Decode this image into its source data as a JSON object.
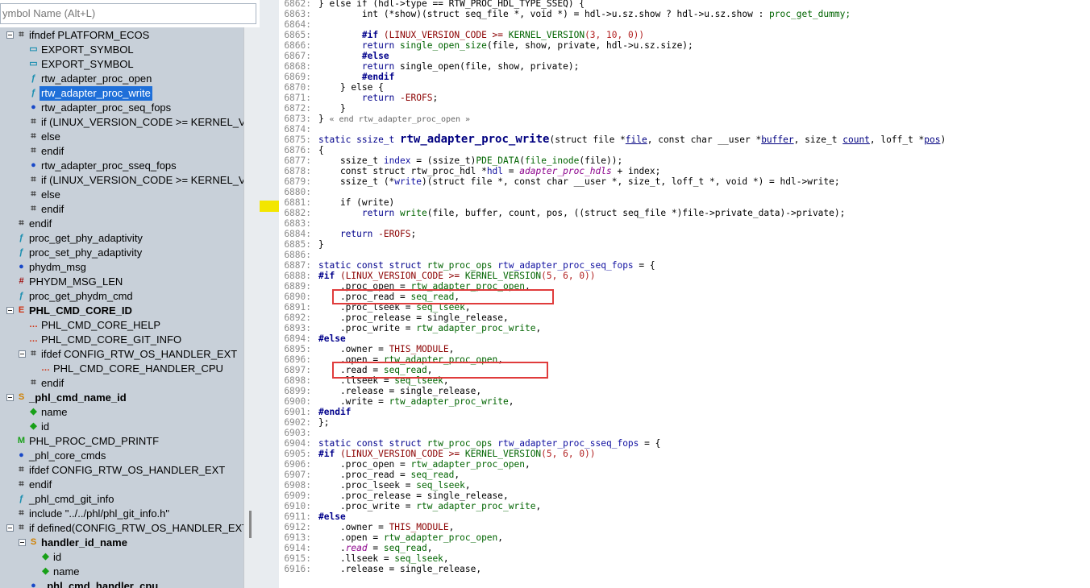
{
  "search": {
    "placeholder": "ymbol Name (Alt+L)"
  },
  "tree": [
    {
      "label": "ifndef PLATFORM_ECOS",
      "indent": 0,
      "box": true,
      "icon": "preproc-icon",
      "bold": false,
      "sel": false
    },
    {
      "label": "EXPORT_SYMBOL",
      "indent": 1,
      "box": false,
      "icon": "macro-call-icon",
      "bold": false,
      "sel": false
    },
    {
      "label": "EXPORT_SYMBOL",
      "indent": 1,
      "box": false,
      "icon": "macro-call-icon",
      "bold": false,
      "sel": false
    },
    {
      "label": "rtw_adapter_proc_open",
      "indent": 1,
      "box": false,
      "icon": "function-icon",
      "bold": false,
      "sel": false
    },
    {
      "label": "rtw_adapter_proc_write",
      "indent": 1,
      "box": false,
      "icon": "function-icon",
      "bold": false,
      "sel": true
    },
    {
      "label": "rtw_adapter_proc_seq_fops",
      "indent": 1,
      "box": false,
      "icon": "variable-icon",
      "bold": false,
      "sel": false
    },
    {
      "label": "if (LINUX_VERSION_CODE >= KERNEL_VER",
      "indent": 1,
      "box": false,
      "icon": "preproc-icon",
      "bold": false,
      "sel": false
    },
    {
      "label": "else",
      "indent": 1,
      "box": false,
      "icon": "preproc-icon",
      "bold": false,
      "sel": false
    },
    {
      "label": "endif",
      "indent": 1,
      "box": false,
      "icon": "preproc-icon",
      "bold": false,
      "sel": false
    },
    {
      "label": "rtw_adapter_proc_sseq_fops",
      "indent": 1,
      "box": false,
      "icon": "variable-icon",
      "bold": false,
      "sel": false
    },
    {
      "label": "if (LINUX_VERSION_CODE >= KERNEL_VER",
      "indent": 1,
      "box": false,
      "icon": "preproc-icon",
      "bold": false,
      "sel": false
    },
    {
      "label": "else",
      "indent": 1,
      "box": false,
      "icon": "preproc-icon",
      "bold": false,
      "sel": false
    },
    {
      "label": "endif",
      "indent": 1,
      "box": false,
      "icon": "preproc-icon",
      "bold": false,
      "sel": false
    },
    {
      "label": "endif",
      "indent": 0,
      "box": false,
      "icon": "preproc-icon",
      "bold": false,
      "sel": false
    },
    {
      "label": "proc_get_phy_adaptivity",
      "indent": 0,
      "box": false,
      "icon": "function-icon",
      "bold": false,
      "sel": false
    },
    {
      "label": "proc_set_phy_adaptivity",
      "indent": 0,
      "box": false,
      "icon": "function-icon",
      "bold": false,
      "sel": false
    },
    {
      "label": "phydm_msg",
      "indent": 0,
      "box": false,
      "icon": "variable-icon",
      "bold": false,
      "sel": false
    },
    {
      "label": "PHYDM_MSG_LEN",
      "indent": 0,
      "box": false,
      "icon": "define-icon",
      "bold": false,
      "sel": false
    },
    {
      "label": "proc_get_phydm_cmd",
      "indent": 0,
      "box": false,
      "icon": "function-icon",
      "bold": false,
      "sel": false
    },
    {
      "label": "PHL_CMD_CORE_ID",
      "indent": 0,
      "box": true,
      "icon": "enum-icon",
      "bold": true,
      "sel": false
    },
    {
      "label": "PHL_CMD_CORE_HELP",
      "indent": 1,
      "box": false,
      "icon": "enum-member-icon",
      "bold": false,
      "sel": false
    },
    {
      "label": "PHL_CMD_CORE_GIT_INFO",
      "indent": 1,
      "box": false,
      "icon": "enum-member-icon",
      "bold": false,
      "sel": false
    },
    {
      "label": "ifdef CONFIG_RTW_OS_HANDLER_EXT",
      "indent": 1,
      "box": true,
      "icon": "preproc-icon",
      "bold": false,
      "sel": false
    },
    {
      "label": "PHL_CMD_CORE_HANDLER_CPU",
      "indent": 2,
      "box": false,
      "icon": "enum-member-icon",
      "bold": false,
      "sel": false
    },
    {
      "label": "endif",
      "indent": 1,
      "box": false,
      "icon": "preproc-icon",
      "bold": false,
      "sel": false
    },
    {
      "label": "_phl_cmd_name_id",
      "indent": 0,
      "box": true,
      "icon": "struct-icon",
      "bold": true,
      "sel": false
    },
    {
      "label": "name",
      "indent": 1,
      "box": false,
      "icon": "field-icon",
      "bold": false,
      "sel": false
    },
    {
      "label": "id",
      "indent": 1,
      "box": false,
      "icon": "field-icon",
      "bold": false,
      "sel": false
    },
    {
      "label": "PHL_PROC_CMD_PRINTF",
      "indent": 0,
      "box": false,
      "icon": "macro-icon",
      "bold": false,
      "sel": false
    },
    {
      "label": "_phl_core_cmds",
      "indent": 0,
      "box": false,
      "icon": "variable-icon",
      "bold": false,
      "sel": false
    },
    {
      "label": "ifdef CONFIG_RTW_OS_HANDLER_EXT",
      "indent": 0,
      "box": false,
      "icon": "preproc-icon",
      "bold": false,
      "sel": false
    },
    {
      "label": "endif",
      "indent": 0,
      "box": false,
      "icon": "preproc-icon",
      "bold": false,
      "sel": false
    },
    {
      "label": "_phl_cmd_git_info",
      "indent": 0,
      "box": false,
      "icon": "function-icon",
      "bold": false,
      "sel": false
    },
    {
      "label": "include \"../../phl/phl_git_info.h\"",
      "indent": 0,
      "box": false,
      "icon": "preproc-icon",
      "bold": false,
      "sel": false
    },
    {
      "label": "if defined(CONFIG_RTW_OS_HANDLER_EXT)",
      "indent": 0,
      "box": true,
      "icon": "preproc-icon",
      "bold": false,
      "sel": false
    },
    {
      "label": "handler_id_name",
      "indent": 1,
      "box": true,
      "icon": "struct-icon",
      "bold": true,
      "sel": false
    },
    {
      "label": "id",
      "indent": 2,
      "box": false,
      "icon": "field-icon",
      "bold": false,
      "sel": false
    },
    {
      "label": "name",
      "indent": 2,
      "box": false,
      "icon": "field-icon",
      "bold": false,
      "sel": false
    },
    {
      "label": "_phl_cmd_handler_cpu",
      "indent": 1,
      "box": false,
      "icon": "variable-icon",
      "bold": true,
      "sel": false
    }
  ],
  "code": [
    {
      "n": "6862:",
      "s": [
        [
          "} else if (hdl->type == RTW_PROC_HDL_TYPE_SSEQ) {",
          ""
        ]
      ]
    },
    {
      "n": "6863:",
      "s": [
        [
          "        int (*show)(struct seq_file *, void *) = hdl->u.sz.show ? hdl->u.sz.show : ",
          ""
        ],
        [
          "proc_get_dummy;",
          "t-fn"
        ]
      ]
    },
    {
      "n": "6864:",
      "s": []
    },
    {
      "n": "6865:",
      "s": [
        [
          "        ",
          ""
        ],
        [
          "#if",
          "t-pp"
        ],
        [
          " (LINUX_VERSION_CODE >= ",
          "t-mac"
        ],
        [
          "KERNEL_VERSION",
          "t-fn"
        ],
        [
          "(3, 10, 0))",
          "t-num"
        ]
      ]
    },
    {
      "n": "6866:",
      "s": [
        [
          "        return ",
          "t-kw"
        ],
        [
          "single_open_size",
          "t-fn"
        ],
        [
          "(file, show, private, hdl->u.sz.size);",
          ""
        ]
      ]
    },
    {
      "n": "6867:",
      "s": [
        [
          "        ",
          ""
        ],
        [
          "#else",
          "t-pp"
        ]
      ]
    },
    {
      "n": "6868:",
      "s": [
        [
          "        return ",
          "t-kw"
        ],
        [
          "single_open(file, show, private);",
          ""
        ]
      ]
    },
    {
      "n": "6869:",
      "s": [
        [
          "        ",
          ""
        ],
        [
          "#endif",
          "t-pp"
        ]
      ]
    },
    {
      "n": "6870:",
      "s": [
        [
          "    } else {",
          ""
        ]
      ]
    },
    {
      "n": "6871:",
      "s": [
        [
          "        return ",
          "t-kw"
        ],
        [
          "-EROFS",
          "t-mac"
        ],
        [
          ";",
          ""
        ]
      ]
    },
    {
      "n": "6872:",
      "s": [
        [
          "    }",
          ""
        ]
      ]
    },
    {
      "n": "6873:",
      "s": [
        [
          "} ",
          ""
        ],
        [
          "« end rtw_adapter_proc_open »",
          "t-gray"
        ]
      ]
    },
    {
      "n": "6874:",
      "s": []
    },
    {
      "n": "6875:",
      "s": [
        [
          "static ssize_t ",
          "t-kw"
        ],
        [
          "rtw_adapter_proc_write",
          "t-fdef"
        ],
        [
          "(struct file *",
          ""
        ],
        [
          "file",
          "t-prm"
        ],
        [
          ", const char __user *",
          ""
        ],
        [
          "buffer",
          "t-prm"
        ],
        [
          ", size_t ",
          ""
        ],
        [
          "count",
          "t-prm"
        ],
        [
          ", loff_t *",
          ""
        ],
        [
          "pos",
          "t-prm"
        ],
        [
          ")",
          ""
        ]
      ]
    },
    {
      "n": "6876:",
      "s": [
        [
          "{",
          ""
        ]
      ]
    },
    {
      "n": "6877:",
      "s": [
        [
          "    ssize_t ",
          ""
        ],
        [
          "index",
          "t-var"
        ],
        [
          " = (ssize_t)",
          ""
        ],
        [
          "PDE_DATA",
          "t-fn"
        ],
        [
          "(",
          ""
        ],
        [
          "file_inode",
          "t-fn"
        ],
        [
          "(file));",
          ""
        ]
      ]
    },
    {
      "n": "6878:",
      "s": [
        [
          "    const struct rtw_proc_hdl *",
          ""
        ],
        [
          "hdl",
          "t-var"
        ],
        [
          " = ",
          ""
        ],
        [
          "adapter_proc_hdls",
          "t-it"
        ],
        [
          " + index;",
          ""
        ]
      ]
    },
    {
      "n": "6879:",
      "s": [
        [
          "    ssize_t (*",
          ""
        ],
        [
          "write",
          "t-var"
        ],
        [
          ")(struct file *, const char __user *, size_t, loff_t *, void *) = hdl->write;",
          ""
        ]
      ]
    },
    {
      "n": "6880:",
      "s": []
    },
    {
      "n": "6881:",
      "s": [
        [
          "    if (write)",
          ""
        ]
      ]
    },
    {
      "n": "6882:",
      "s": [
        [
          "        return ",
          "t-kw"
        ],
        [
          "write",
          "t-fn"
        ],
        [
          "(file, buffer, count, pos, ((struct seq_file *)file->private_data)->private);",
          ""
        ]
      ]
    },
    {
      "n": "6883:",
      "s": []
    },
    {
      "n": "6884:",
      "s": [
        [
          "    return ",
          "t-kw"
        ],
        [
          "-EROFS",
          "t-mac"
        ],
        [
          ";",
          ""
        ]
      ]
    },
    {
      "n": "6885:",
      "s": [
        [
          "}",
          ""
        ]
      ]
    },
    {
      "n": "6886:",
      "s": []
    },
    {
      "n": "6887:",
      "s": [
        [
          "static const struct ",
          "t-kw"
        ],
        [
          "rtw_proc_ops ",
          "t-fn"
        ],
        [
          "rtw_adapter_proc_seq_fops",
          "t-var"
        ],
        [
          " = {",
          ""
        ]
      ]
    },
    {
      "n": "6888:",
      "s": [
        [
          "#if",
          "t-pp"
        ],
        [
          " (LINUX_VERSION_CODE >= ",
          "t-mac"
        ],
        [
          "KERNEL_VERSION",
          "t-fn"
        ],
        [
          "(5, 6, 0))",
          "t-num"
        ]
      ]
    },
    {
      "n": "6889:",
      "s": [
        [
          "    .proc_open = ",
          ""
        ],
        [
          "rtw_adapter_proc_open",
          "t-fn"
        ],
        [
          ",",
          ""
        ]
      ]
    },
    {
      "n": "6890:",
      "s": [
        [
          "    .proc_read = ",
          ""
        ],
        [
          "seq_read",
          "t-fn"
        ],
        [
          ",",
          ""
        ]
      ]
    },
    {
      "n": "6891:",
      "s": [
        [
          "    .proc_lseek = ",
          ""
        ],
        [
          "seq_lseek",
          "t-fn"
        ],
        [
          ",",
          ""
        ]
      ]
    },
    {
      "n": "6892:",
      "s": [
        [
          "    .proc_release = single_release,",
          ""
        ]
      ]
    },
    {
      "n": "6893:",
      "s": [
        [
          "    .proc_write = ",
          ""
        ],
        [
          "rtw_adapter_proc_write",
          "t-fn"
        ],
        [
          ",",
          ""
        ]
      ]
    },
    {
      "n": "6894:",
      "s": [
        [
          "#else",
          "t-pp"
        ]
      ]
    },
    {
      "n": "6895:",
      "s": [
        [
          "    .owner = ",
          ""
        ],
        [
          "THIS_MODULE",
          "t-mac"
        ],
        [
          ",",
          ""
        ]
      ]
    },
    {
      "n": "6896:",
      "s": [
        [
          "    .open = ",
          ""
        ],
        [
          "rtw_adapter_proc_open",
          "t-fn"
        ],
        [
          ",",
          ""
        ]
      ]
    },
    {
      "n": "6897:",
      "s": [
        [
          "    .read = ",
          ""
        ],
        [
          "seq_read",
          "t-fn"
        ],
        [
          ",",
          ""
        ]
      ]
    },
    {
      "n": "6898:",
      "s": [
        [
          "    .llseek = ",
          ""
        ],
        [
          "seq_lseek",
          "t-fn"
        ],
        [
          ",",
          ""
        ]
      ]
    },
    {
      "n": "6899:",
      "s": [
        [
          "    .release = single_release,",
          ""
        ]
      ]
    },
    {
      "n": "6900:",
      "s": [
        [
          "    .write = ",
          ""
        ],
        [
          "rtw_adapter_proc_write",
          "t-fn"
        ],
        [
          ",",
          ""
        ]
      ]
    },
    {
      "n": "6901:",
      "s": [
        [
          "#endif",
          "t-pp"
        ]
      ]
    },
    {
      "n": "6902:",
      "s": [
        [
          "};",
          ""
        ]
      ]
    },
    {
      "n": "6903:",
      "s": []
    },
    {
      "n": "6904:",
      "s": [
        [
          "static const struct ",
          "t-kw"
        ],
        [
          "rtw_proc_ops ",
          "t-fn"
        ],
        [
          "rtw_adapter_proc_sseq_fops",
          "t-var"
        ],
        [
          " = {",
          ""
        ]
      ]
    },
    {
      "n": "6905:",
      "s": [
        [
          "#if",
          "t-pp"
        ],
        [
          " (LINUX_VERSION_CODE >= ",
          "t-mac"
        ],
        [
          "KERNEL_VERSION",
          "t-fn"
        ],
        [
          "(5, 6, 0))",
          "t-num"
        ]
      ]
    },
    {
      "n": "6906:",
      "s": [
        [
          "    .proc_open = ",
          ""
        ],
        [
          "rtw_adapter_proc_open",
          "t-fn"
        ],
        [
          ",",
          ""
        ]
      ]
    },
    {
      "n": "6907:",
      "s": [
        [
          "    .proc_read = ",
          ""
        ],
        [
          "seq_read",
          "t-fn"
        ],
        [
          ",",
          ""
        ]
      ]
    },
    {
      "n": "6908:",
      "s": [
        [
          "    .proc_lseek = ",
          ""
        ],
        [
          "seq_lseek",
          "t-fn"
        ],
        [
          ",",
          ""
        ]
      ]
    },
    {
      "n": "6909:",
      "s": [
        [
          "    .proc_release = single_release,",
          ""
        ]
      ]
    },
    {
      "n": "6910:",
      "s": [
        [
          "    .proc_write = ",
          ""
        ],
        [
          "rtw_adapter_proc_write",
          "t-fn"
        ],
        [
          ",",
          ""
        ]
      ]
    },
    {
      "n": "6911:",
      "s": [
        [
          "#else",
          "t-pp"
        ]
      ]
    },
    {
      "n": "6912:",
      "s": [
        [
          "    .owner = ",
          ""
        ],
        [
          "THIS_MODULE",
          "t-mac"
        ],
        [
          ",",
          ""
        ]
      ]
    },
    {
      "n": "6913:",
      "s": [
        [
          "    .open = ",
          ""
        ],
        [
          "rtw_adapter_proc_open",
          "t-fn"
        ],
        [
          ",",
          ""
        ]
      ]
    },
    {
      "n": "6914:",
      "s": [
        [
          "    .",
          ""
        ],
        [
          "read",
          "t-it"
        ],
        [
          " = ",
          ""
        ],
        [
          "seq_read",
          "t-fn"
        ],
        [
          ",",
          ""
        ]
      ]
    },
    {
      "n": "6915:",
      "s": [
        [
          "    .llseek = ",
          ""
        ],
        [
          "seq_lseek",
          "t-fn"
        ],
        [
          ",",
          ""
        ]
      ]
    },
    {
      "n": "6916:",
      "s": [
        [
          "    .release = single_release,",
          ""
        ]
      ]
    }
  ],
  "colors": {
    "selection": "#1e6fd9",
    "highlight_box": "#e03c3c",
    "tree_bg": "#c8d0d9",
    "marker": "#f3e600"
  }
}
